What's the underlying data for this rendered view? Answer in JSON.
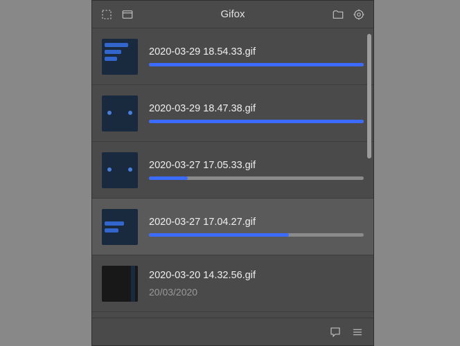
{
  "app": {
    "title": "Gifox"
  },
  "items": [
    {
      "filename": "2020-03-29 18.54.33.gif",
      "progress": 100,
      "selected": false,
      "thumb": "chat"
    },
    {
      "filename": "2020-03-29 18.47.38.gif",
      "progress": 100,
      "selected": false,
      "thumb": "dots"
    },
    {
      "filename": "2020-03-27 17.05.33.gif",
      "progress": 18,
      "selected": false,
      "thumb": "dots"
    },
    {
      "filename": "2020-03-27 17.04.27.gif",
      "progress": 65,
      "selected": true,
      "thumb": "chat"
    },
    {
      "filename": "2020-03-20 14.32.56.gif",
      "subtext": "20/03/2020",
      "selected": false,
      "thumb": "dark"
    }
  ]
}
